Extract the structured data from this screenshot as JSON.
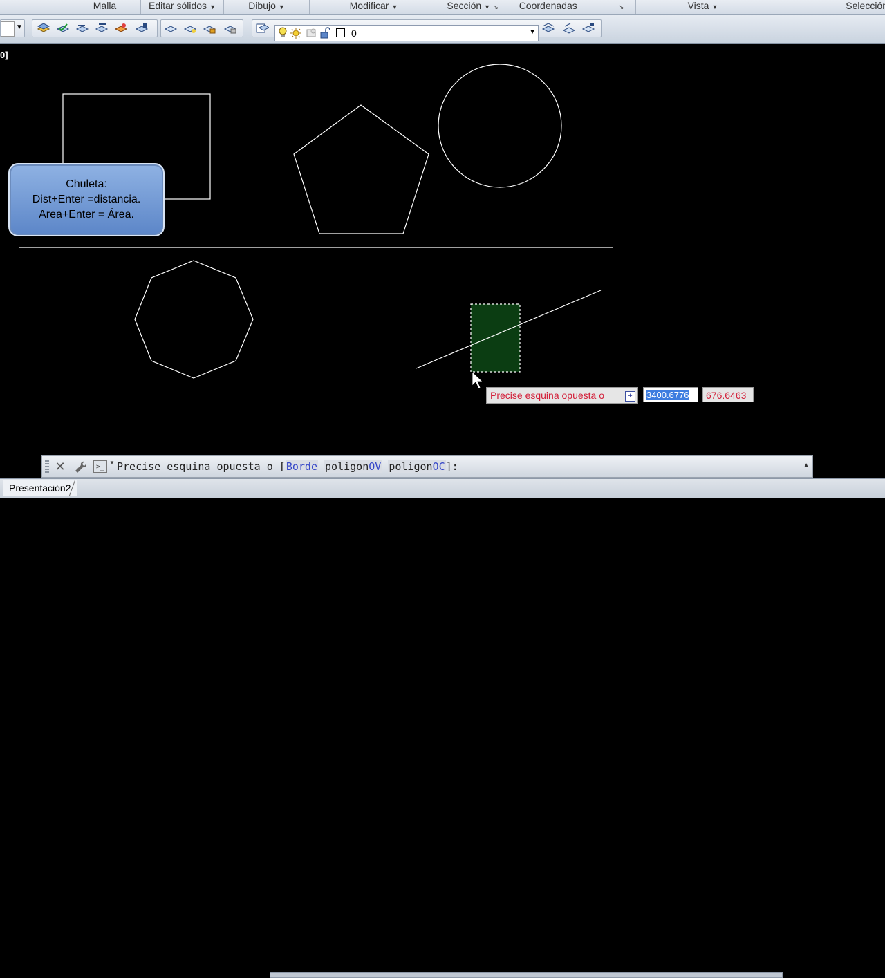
{
  "ribbon": {
    "panels": [
      "Malla",
      "Editar sólidos",
      "Dibujo",
      "Modificar",
      "Sección",
      "Coordenadas",
      "Vista",
      "Selección"
    ]
  },
  "toolbar": {
    "layer_value": "0"
  },
  "viewport": {
    "label": "0]"
  },
  "tip": {
    "line1": "Chuleta:",
    "line2": "Dist+Enter =distancia.",
    "line3": "Area+Enter = Área."
  },
  "dynamic_input": {
    "prompt": "Precise esquina opuesta o",
    "x_value": "3400.6776",
    "y_value": "676.6463"
  },
  "command_line": {
    "prefix": "Precise esquina opuesta o [",
    "opt1": "Borde",
    "opt2_base": "poligon",
    "opt2_key": "OV",
    "opt3_base": "poligon",
    "opt3_key": "OC",
    "suffix": "]:"
  },
  "layout_tabs": {
    "active": "Presentación2"
  },
  "colors": {
    "canvas_bg": "#000000",
    "geometry_stroke": "#ffffff",
    "selection_fill": "#0b3d12",
    "prompt_text": "#d3203a"
  }
}
